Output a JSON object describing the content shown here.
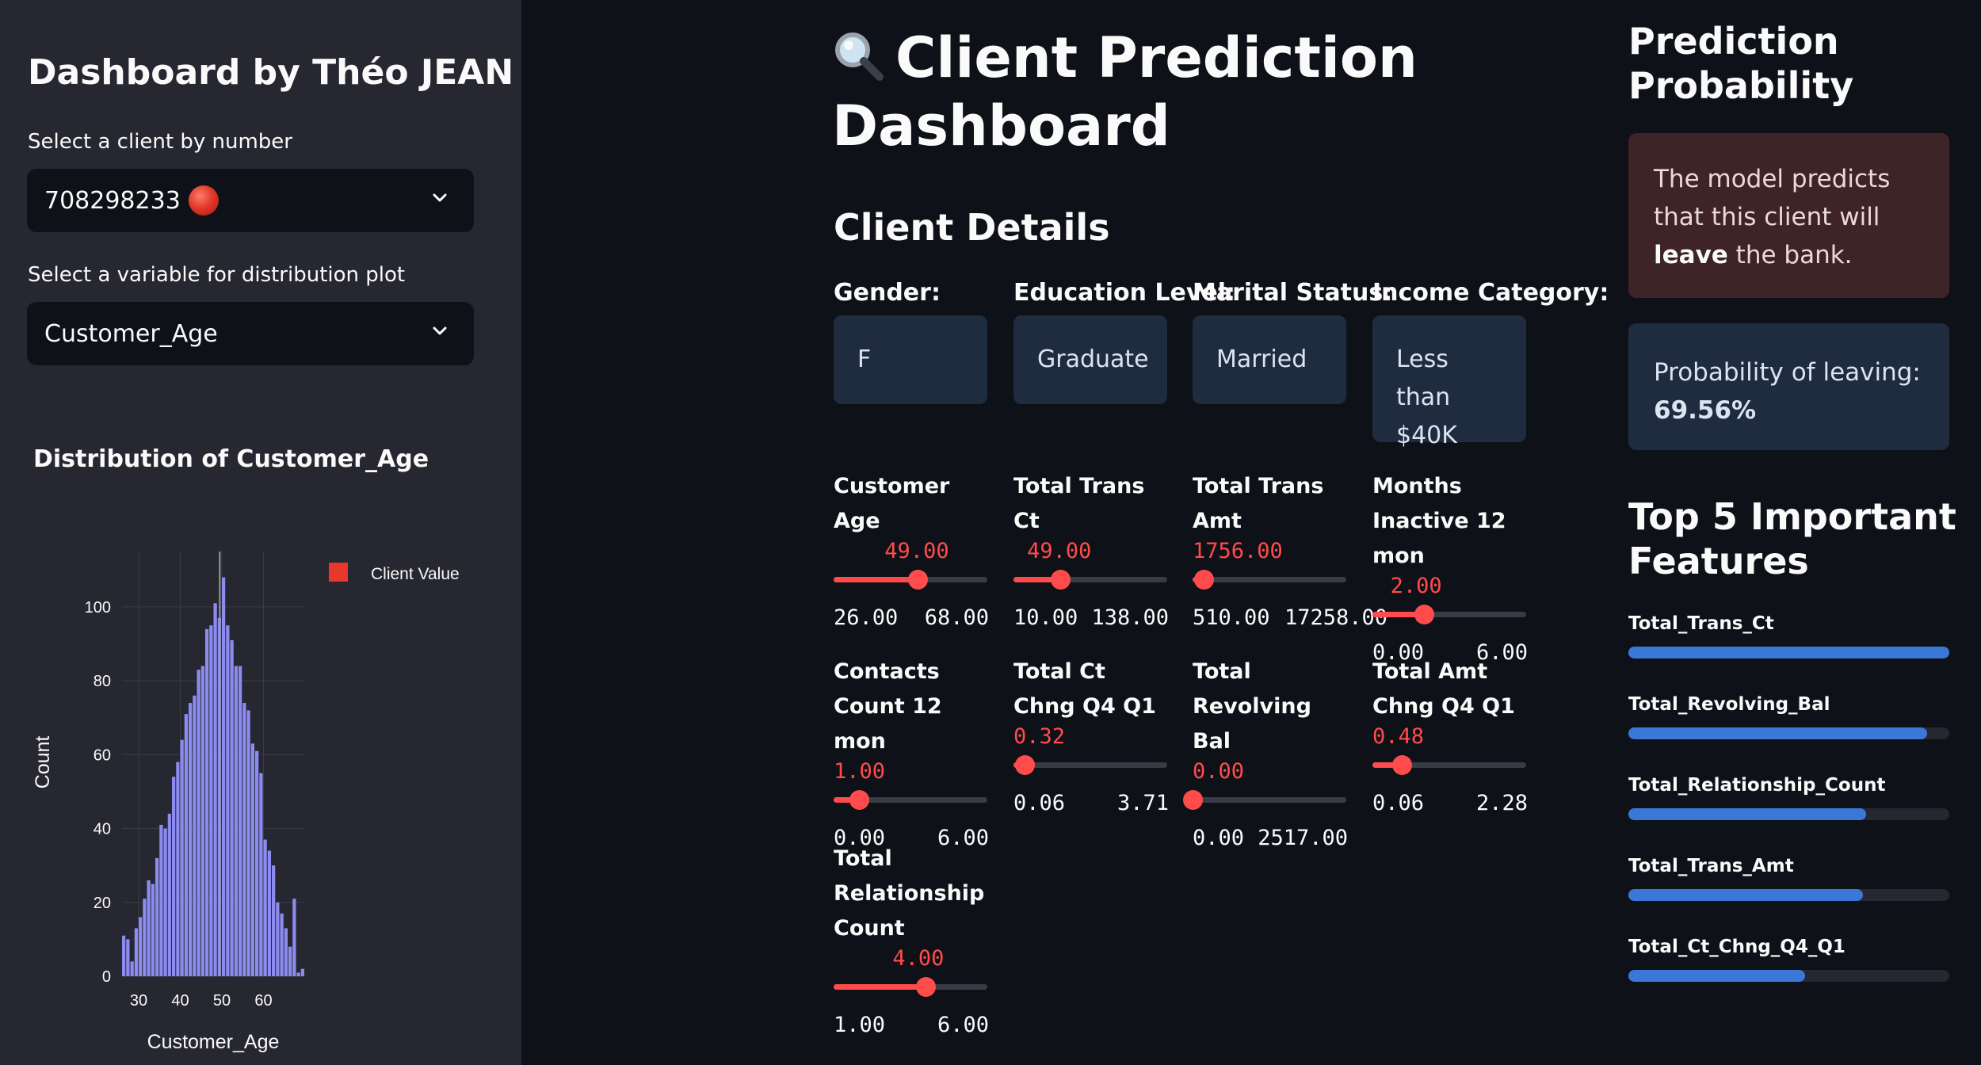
{
  "sidebar": {
    "title": "Dashboard by Théo JEAN",
    "client_select": {
      "label": "Select a client by number",
      "value": "708298233"
    },
    "variable_select": {
      "label": "Select a variable for distribution plot",
      "value": "Customer_Age"
    },
    "chart_title": "Distribution of Customer_Age"
  },
  "chart_data": {
    "type": "bar",
    "xlabel": "Customer_Age",
    "ylabel": "Count",
    "x_ticks": [
      30,
      40,
      50,
      60
    ],
    "y_ticks": [
      0,
      20,
      40,
      60,
      80,
      100
    ],
    "xlim": [
      26,
      70
    ],
    "ylim": [
      0,
      115
    ],
    "legend": "Client Value",
    "legend_position": "top-right",
    "client_value": 49,
    "grid": true,
    "colors": {
      "bars": "#8c8cf0",
      "client_line": "#9a9a9a",
      "legend_marker": "#e8372b"
    },
    "categories": [
      26,
      27,
      28,
      29,
      30,
      31,
      32,
      33,
      34,
      35,
      36,
      37,
      38,
      39,
      40,
      41,
      42,
      43,
      44,
      45,
      46,
      47,
      48,
      49,
      50,
      51,
      52,
      53,
      54,
      55,
      56,
      57,
      58,
      59,
      60,
      61,
      62,
      63,
      64,
      65,
      66,
      67,
      68,
      69
    ],
    "values": [
      11,
      10,
      4,
      13,
      16,
      21,
      26,
      25,
      32,
      41,
      40,
      44,
      54,
      58,
      64,
      71,
      74,
      76,
      83,
      84,
      94,
      95,
      101,
      97,
      108,
      95,
      91,
      84,
      84,
      74,
      72,
      63,
      61,
      55,
      37,
      34,
      30,
      20,
      17,
      13,
      8,
      21,
      1,
      2
    ]
  },
  "main": {
    "title": "Client Prediction Dashboard",
    "section": "Client Details",
    "categories": [
      {
        "label": "Gender:",
        "value": "F"
      },
      {
        "label": "Education Level:",
        "value": "Graduate"
      },
      {
        "label": "Marital Status:",
        "value": "Married"
      },
      {
        "label": "Income Category:",
        "value": "Less than $40K"
      }
    ],
    "metrics": [
      {
        "label": "Customer Age",
        "value": "49.00",
        "min": "26.00",
        "max": "68.00",
        "frac": 0.548
      },
      {
        "label": "Total Trans Ct",
        "value": "49.00",
        "min": "10.00",
        "max": "138.00",
        "frac": 0.305
      },
      {
        "label": "Total Trans Amt",
        "value": "1756.00",
        "min": "510.00",
        "max": "17258.00",
        "frac": 0.074
      },
      {
        "label": "Months Inactive 12 mon",
        "value": "2.00",
        "min": "0.00",
        "max": "6.00",
        "frac": 0.333
      },
      {
        "label": "Contacts Count 12 mon",
        "value": "1.00",
        "min": "0.00",
        "max": "6.00",
        "frac": 0.167
      },
      {
        "label": "Total Ct Chng Q4 Q1",
        "value": "0.32",
        "min": "0.06",
        "max": "3.71",
        "frac": 0.071
      },
      {
        "label": "Total Revolving Bal",
        "value": "0.00",
        "min": "0.00",
        "max": "2517.00",
        "frac": 0.0
      },
      {
        "label": "Total Amt Chng Q4 Q1",
        "value": "0.48",
        "min": "0.06",
        "max": "2.28",
        "frac": 0.189
      },
      {
        "label": "Total Relationship Count",
        "value": "4.00",
        "min": "1.00",
        "max": "6.00",
        "frac": 0.6
      }
    ]
  },
  "right": {
    "prob_title": "Prediction Probability",
    "prediction_pre": "The model predicts that this client will ",
    "prediction_bold": "leave",
    "prediction_post": " the bank.",
    "prob_label": "Probability of leaving:",
    "prob_value": "69.56%",
    "features_title": "Top 5 Important Features",
    "features": [
      {
        "name": "Total_Trans_Ct",
        "importance": 1.0
      },
      {
        "name": "Total_Revolving_Bal",
        "importance": 0.93
      },
      {
        "name": "Total_Relationship_Count",
        "importance": 0.74
      },
      {
        "name": "Total_Trans_Amt",
        "importance": 0.73
      },
      {
        "name": "Total_Ct_Chng_Q4_Q1",
        "importance": 0.55
      }
    ]
  },
  "colors": {
    "accent": "#ff4b4b",
    "sidebar_bg": "#262730",
    "app_bg": "#0e1117",
    "info_bg": "#1f2b3e",
    "error_bg": "#3e2426",
    "feature_bar": "#3a78d8"
  }
}
